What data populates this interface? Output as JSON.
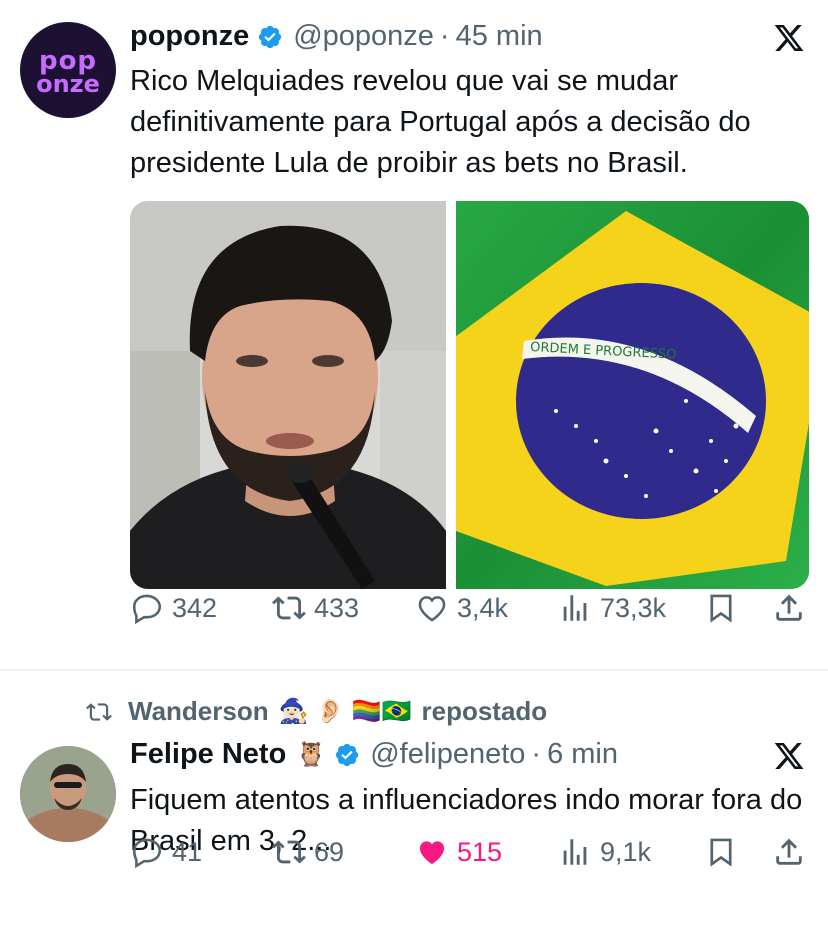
{
  "tweet1": {
    "avatar_text_top": "pop",
    "avatar_text_bottom": "onze",
    "name": "poponze",
    "handle": "@poponze",
    "separator": "·",
    "time": "45 min",
    "text": "Rico Melquiades revelou que vai se mudar definitivamente para Portugal após a decisão do presidente Lula de proibir as bets no Brasil.",
    "flag_motto": "ORDEM E PROGRESSO",
    "actions": {
      "replies": "342",
      "reposts": "433",
      "likes": "3,4k",
      "views": "73,3k"
    }
  },
  "repost_banner": {
    "name": "Wanderson",
    "emojis": "🧙🏻‍♀️ 👂🏻 🏳️‍🌈🇧🇷",
    "label": "repostado"
  },
  "tweet2": {
    "name": "Felipe Neto",
    "name_emoji": "🦉",
    "handle": "@felipeneto",
    "separator": "·",
    "time": "6 min",
    "text": "Fiquem atentos a influenciadores indo morar fora do Brasil em 3, 2...",
    "actions": {
      "replies": "41",
      "reposts": "69",
      "likes": "515",
      "views": "9,1k"
    }
  },
  "colors": {
    "text_primary": "#0f1419",
    "text_secondary": "#536471",
    "verified_blue": "#1d9bf0",
    "like_pink": "#f91880",
    "divider": "#eff3f4"
  },
  "icons": [
    "verified-badge-icon",
    "x-logo-icon",
    "reply-icon",
    "repost-icon",
    "like-icon",
    "views-icon",
    "bookmark-icon",
    "share-icon"
  ]
}
